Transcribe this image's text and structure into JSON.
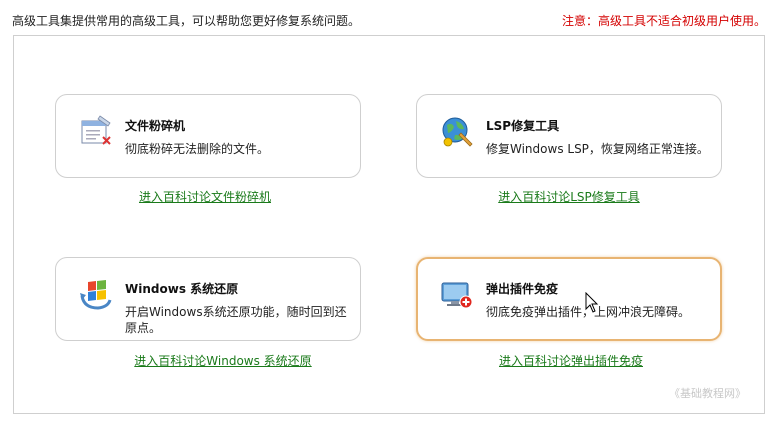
{
  "header": {
    "description": "高级工具集提供常用的高级工具，可以帮助您更好修复系统问题。",
    "warning": "注意：高级工具不适合初级用户使用。"
  },
  "tools": [
    {
      "icon": "file-shredder-icon",
      "title": "文件粉碎机",
      "desc": "彻底粉碎无法删除的文件。",
      "link": "进入百科讨论文件粉碎机"
    },
    {
      "icon": "lsp-repair-icon",
      "title": "LSP修复工具",
      "desc": "修复Windows LSP，恢复网络正常连接。",
      "link": "进入百科讨论LSP修复工具"
    },
    {
      "icon": "windows-restore-icon",
      "title": "Windows 系统还原",
      "desc": "开启Windows系统还原功能，随时回到还原点。",
      "link": "进入百科讨论Windows 系统还原"
    },
    {
      "icon": "popup-block-icon",
      "title": "弹出插件免疫",
      "desc": "彻底免疫弹出插件，上网冲浪无障碍。",
      "link": "进入百科讨论弹出插件免疫"
    }
  ],
  "watermark": "《基础教程网》",
  "colors": {
    "warning": "#d40000",
    "link": "#1a7a1a",
    "hover_border": "#e8b472"
  }
}
